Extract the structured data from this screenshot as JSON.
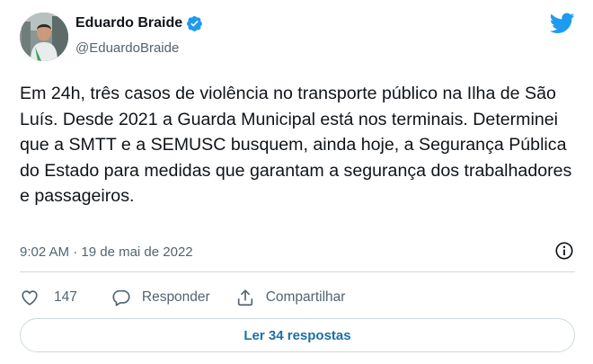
{
  "author": {
    "name": "Eduardo Braide",
    "handle": "@EduardoBraide",
    "verified": true
  },
  "tweet": {
    "text": "Em 24h, três casos de violência no transporte público na Ilha de São Luís. Desde 2021 a Guarda Municipal está nos terminais. Determinei que a SMTT e a SEMUSC busquem, ainda hoje, a Segurança Pública do Estado para medidas que garantam a segurança dos trabalhadores e passageiros.",
    "time": "9:02 AM",
    "separator": "·",
    "date": "19 de mai de 2022"
  },
  "actions": {
    "like_count": "147",
    "reply_label": "Responder",
    "share_label": "Compartilhar"
  },
  "replies_button": "Ler 34 respostas",
  "colors": {
    "brand": "#1d9bf0",
    "link": "#1d6fa5",
    "muted": "#536471",
    "border": "#cfd9de"
  },
  "icons": [
    "avatar",
    "verified-badge-icon",
    "twitter-logo-icon",
    "info-icon",
    "heart-icon",
    "reply-bubble-icon",
    "share-icon"
  ]
}
